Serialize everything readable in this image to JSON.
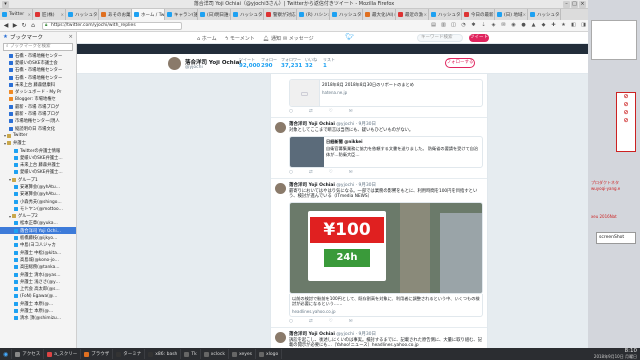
{
  "window": {
    "title": "落合洋司 Yoji Ochiai（@yjochi3さん）| Twitterから返信付きツイート - Mozilla Firefox"
  },
  "tabs": [
    {
      "label": "Twitter",
      "color": "#1da1f2",
      "active": false
    },
    {
      "label": "匠(株) ",
      "color": "#d33",
      "active": false
    },
    {
      "label": "ハッシュタグ",
      "color": "#1da1f2",
      "active": false
    },
    {
      "label": "あそのお菓",
      "color": "#e07020",
      "active": false
    },
    {
      "label": "ホーム / Tw",
      "color": "#1da1f2",
      "active": true
    },
    {
      "label": "キャラン(誰)",
      "color": "#1da1f2",
      "active": false
    },
    {
      "label": "(日)明日誰",
      "color": "#1da1f2",
      "active": false
    },
    {
      "label": "ハッシュタグ",
      "color": "#1da1f2",
      "active": false
    },
    {
      "label": "警察が対応",
      "color": "#d33",
      "active": false
    },
    {
      "label": "(R) ハシン",
      "color": "#1da1f2",
      "active": false
    },
    {
      "label": "ハッシュタグ",
      "color": "#1da1f2",
      "active": false
    },
    {
      "label": "最大化(AI)",
      "color": "#e07020",
      "active": false
    },
    {
      "label": "最近の漁",
      "color": "#d33",
      "active": false
    },
    {
      "label": "ハッシュタグ",
      "color": "#1da1f2",
      "active": false
    },
    {
      "label": "今日の最新",
      "color": "#d33",
      "active": false
    },
    {
      "label": "(日) 地域",
      "color": "#1da1f2",
      "active": false
    },
    {
      "label": "ハッシュタグ",
      "color": "#1da1f2",
      "active": false
    }
  ],
  "urlbar": {
    "value": "https://twitter.com/yjochi/with_replies"
  },
  "sidebar": {
    "title": "ブックマーク",
    "search_placeholder": "ブックマークを検索",
    "items": [
      {
        "label": "石橋・市場地権センター",
        "color": "#2a6fd6",
        "indent": 1,
        "selected": false
      },
      {
        "label": "愛緩いのSKE市議士会",
        "color": "#2a6fd6",
        "indent": 1,
        "selected": false
      },
      {
        "label": "石橋・市場地権センター",
        "color": "#2a6fd6",
        "indent": 1,
        "selected": false
      },
      {
        "label": "石橋・市場地権センター",
        "color": "#2a6fd6",
        "indent": 1,
        "selected": false
      },
      {
        "label": "未来上台 藤森健康科",
        "color": "#2a6fd6",
        "indent": 1,
        "selected": false
      },
      {
        "label": "ダッシュボード - My Pr",
        "color": "#f08a24",
        "indent": 1,
        "selected": false
      },
      {
        "label": "Blogger: 市場地権セ",
        "color": "#f08a24",
        "indent": 1,
        "selected": false
      },
      {
        "label": "最新・市場 市場ブログ",
        "color": "#2a6fd6",
        "indent": 1,
        "selected": false
      },
      {
        "label": "最新・市場 市場ブログ",
        "color": "#2a6fd6",
        "indent": 1,
        "selected": false
      },
      {
        "label": "市場地権センター(現人",
        "color": "#2a6fd6",
        "indent": 1,
        "selected": false
      },
      {
        "label": "縦読明の日 市場文化",
        "color": "#2a6fd6",
        "indent": 1,
        "selected": false
      },
      {
        "label": "Twitter",
        "color": "#888",
        "indent": 0,
        "selected": false,
        "folder": true
      },
      {
        "label": "弁護士",
        "color": "#888",
        "indent": 0,
        "selected": false,
        "folder": true
      },
      {
        "label": "Twitterの弁護士情報",
        "color": "#1da1f2",
        "indent": 2,
        "selected": false
      },
      {
        "label": "愛緩いのSKE弁護士…",
        "color": "#1da1f2",
        "indent": 2,
        "selected": false
      },
      {
        "label": "未来上台 藤森弁護士",
        "color": "#1da1f2",
        "indent": 2,
        "selected": false
      },
      {
        "label": "愛緩いのSKE弁護士…",
        "color": "#1da1f2",
        "indent": 2,
        "selected": false
      },
      {
        "label": "グループ1",
        "color": "#888",
        "indent": 1,
        "selected": false,
        "folder": true
      },
      {
        "label": "安運算会(@yhAtu…",
        "color": "#1da1f2",
        "indent": 2,
        "selected": false
      },
      {
        "label": "安運算会(@yhAtu…",
        "color": "#1da1f2",
        "indent": 2,
        "selected": false
      },
      {
        "label": "小森秀夫(@shingo…",
        "color": "#1da1f2",
        "indent": 2,
        "selected": false
      },
      {
        "label": "モトヤン(@mottoo…",
        "color": "#1da1f2",
        "indent": 2,
        "selected": false
      },
      {
        "label": "グループ2",
        "color": "#888",
        "indent": 1,
        "selected": false,
        "folder": true
      },
      {
        "label": "松本正章(@yuka…",
        "color": "#1da1f2",
        "indent": 2,
        "selected": false
      },
      {
        "label": "落合洋司 Yoji Ochi…",
        "color": "#1da1f2",
        "indent": 2,
        "selected": true
      },
      {
        "label": "板橋藤枝(@ijkyo…",
        "color": "#1da1f2",
        "indent": 2,
        "selected": false
      },
      {
        "label": "中島(ヨコ人ジャカ",
        "color": "#1da1f2",
        "indent": 2,
        "selected": false
      },
      {
        "label": "弁護士 中松(@kita…",
        "color": "#1da1f2",
        "indent": 2,
        "selected": false
      },
      {
        "label": "高島城(@kono-jo…",
        "color": "#1da1f2",
        "indent": 2,
        "selected": false
      },
      {
        "label": "高田総務(@tanka…",
        "color": "#1da1f2",
        "indent": 2,
        "selected": false
      },
      {
        "label": "弁護士 清水(@yas…",
        "color": "#1da1f2",
        "indent": 2,
        "selected": false
      },
      {
        "label": "弁護士 浅ささ(@y…",
        "color": "#1da1f2",
        "indent": 2,
        "selected": false
      },
      {
        "label": "上代会 高太郎(@s…",
        "color": "#1da1f2",
        "indent": 2,
        "selected": false
      },
      {
        "label": "(FoN) Egawa(@…",
        "color": "#1da1f2",
        "indent": 2,
        "selected": false
      },
      {
        "label": "弁護士 本原(@…",
        "color": "#1da1f2",
        "indent": 2,
        "selected": false
      },
      {
        "label": "弁護士 本原(@…",
        "color": "#1da1f2",
        "indent": 2,
        "selected": false
      },
      {
        "label": "清水 頂(@shimizu…",
        "color": "#1da1f2",
        "indent": 2,
        "selected": false
      }
    ]
  },
  "twitter_nav": {
    "home": "ホーム",
    "moments": "モーメント",
    "notifications": "通知",
    "messages": "メッセージ",
    "search_placeholder": "キーワード検索",
    "tweet_button": "ツイート"
  },
  "profile": {
    "name": "落合洋司 Yoji Ochiai",
    "handle": "@yjochi",
    "stats": [
      {
        "label": "ツイート",
        "value": "92,000"
      },
      {
        "label": "フォロー",
        "value": "290"
      },
      {
        "label": "フォロワー",
        "value": "37,231"
      },
      {
        "label": "いいね",
        "value": "32"
      },
      {
        "label": "リスト",
        "value": "1"
      }
    ],
    "follow_button": "フォローする"
  },
  "tweets": [
    {
      "name": "",
      "handle": "",
      "time": "",
      "text": "",
      "card_text": "2018年8月\n2018年8月30日のリポートのまとめ",
      "card_url": "hatena.ne.jp",
      "has_card": true,
      "has_photo": false,
      "short_card": true
    },
    {
      "name": "落合洋司 Yoji Ochiai",
      "handle": "@yjochi · 9月30日",
      "time": "",
      "text": "対象としてここまで断言は当然にも、疑いもひどいものがない。",
      "quote_name": "日経新聞 @nikkei",
      "quote_text": "自衛官募集業務に協力を依頼する文書を送りました。\n防衛省の要請を受けて自治体が…防衛大臣…",
      "has_card": false,
      "has_photo": false,
      "has_quote": true
    },
    {
      "name": "落合洋司 Yoji Ochiai",
      "handle": "@yjochi · 9月30日",
      "time": "",
      "text": "最寄りにおいてはやはり気になる。一部では業務の影響をもとに、利用時間を100円を目指すという、検討が進んでいる（ITmedia NEWS）",
      "card_text": "以前の検討で駅前を100円として、既存割高を対象に、利用者に調整されるという中、いくつもの検討が必要になるという……",
      "card_url": "headlines.yahoo.co.jp",
      "photo_big": "¥100",
      "photo_sub": "24h",
      "has_card": true,
      "has_photo": true
    },
    {
      "name": "落合洋司 Yoji Ochiai",
      "handle": "@yjochi · 9月30日",
      "time": "",
      "text": "訴訟を起こし、後述しにくいのは事実。検討するまでに、記載された原告側に、大量に取り組む、記載の開示が必要にも…（Yahoo!ニュース）headlines.yahoo.co.jp",
      "has_card": false,
      "has_photo": false
    }
  ],
  "tweet_actions": [
    "○",
    "⇄",
    "♡",
    "✉"
  ],
  "desktop_right": {
    "labels": [
      "プロダクトネタ",
      "wuyoqi-yang.e",
      "xeu 2016Nat",
      "screenShot"
    ]
  },
  "taskbar": {
    "items": [
      {
        "label": "アクセス",
        "color": "#888"
      },
      {
        "label": "a_スクリー",
        "color": "#d44"
      },
      {
        "label": "ブラウザ",
        "color": "#e07020"
      },
      {
        "label": "ターミナ",
        "color": "#333"
      },
      {
        "label": "x86: bash",
        "color": "#333"
      },
      {
        "label": "Tk",
        "color": "#666"
      },
      {
        "label": "xclock",
        "color": "#666"
      },
      {
        "label": "xeyes",
        "color": "#666"
      },
      {
        "label": "xlogo",
        "color": "#666"
      }
    ],
    "clock_time": "8:10",
    "clock_date": "2018年9月10日 月曜日"
  }
}
